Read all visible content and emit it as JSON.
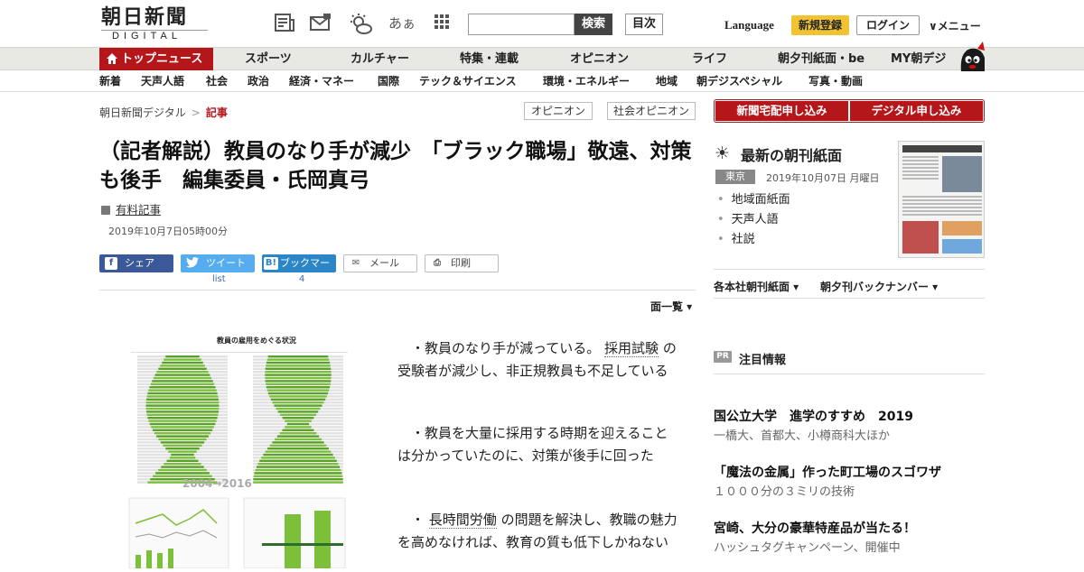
{
  "header": {
    "logo_main": "朝日新聞",
    "logo_sub": "DIGITAL",
    "search_placeholder": "",
    "search_button": "検索",
    "toc_button": "目次",
    "font_toggle_label": "あぁ",
    "language": "Language",
    "signup": "新規登録",
    "login": "ログイン",
    "menu": "∨メニュー"
  },
  "nav_primary": [
    "トップニュース",
    "スポーツ",
    "カルチャー",
    "特集・連載",
    "オピニオン",
    "ライフ",
    "朝夕刊紙面・be",
    "MY朝デジ"
  ],
  "nav_secondary": [
    "新着",
    "天声人語",
    "社会",
    "政治",
    "経済・マネー",
    "国際",
    "テック＆サイエンス",
    "環境・エネルギー",
    "地域",
    "朝デジスペシャル",
    "写真・動画"
  ],
  "breadcrumb": {
    "home": "朝日新聞デジタル",
    "sep": ">",
    "current": "記事"
  },
  "tags": [
    "オピニオン",
    "社会オピニオン"
  ],
  "article": {
    "title": "（記者解説）教員のなり手が減少　「ブラック職場」敬遠、対策も後手　編集委員・氏岡真弓",
    "paid_label": "有料記事",
    "date": "2019年10月7日05時00分",
    "share": {
      "facebook": "シェア",
      "twitter": "ツイート",
      "hatena": "ブックマーク",
      "mail": "メール",
      "print": "印刷",
      "twitter_count": "list",
      "hatena_count": "4"
    },
    "page_list": "面一覧 ▾",
    "figure_title": "教員の雇用をめぐる状況",
    "figure_years": "2004→2016",
    "paragraphs": [
      {
        "pre": "・教員のなり手が減っている。",
        "kw": "採用試験",
        "post": "の受験者が減少し、非正規教員も不足している"
      },
      {
        "pre": "・教員を大量に採用する時期を迎えることは分かっていたのに、対策が後手に回った",
        "kw": "",
        "post": ""
      },
      {
        "pre": "・",
        "kw": "長時間労働",
        "post": "の問題を解決し、教職の魅力を高めなければ、教育の質も低下しかねない"
      }
    ]
  },
  "sidebar": {
    "delivery_button": "新聞宅配申し込み",
    "digital_button": "デジタル申し込み",
    "paper_heading": "最新の朝刊紙面",
    "region": "東京",
    "paper_date": "2019年10月07日 月曜日",
    "paper_links": [
      "地域面紙面",
      "天声人語",
      "社説"
    ],
    "dropdown_1": "各本社朝刊紙面 ▾",
    "dropdown_2": "朝夕刊バックナンバー ▾",
    "pr_badge": "PR",
    "pr_heading": "注目情報",
    "ads": [
      {
        "title": "国公立大学　進学のすすめ　2019",
        "sub": "一橋大、首都大、小樽商科大ほか"
      },
      {
        "title": "「魔法の金属」作った町工場のスゴワザ",
        "sub": "１０００分の３ミリの技術"
      },
      {
        "title": "宮崎、大分の豪華特産品が当たる！",
        "sub": "ハッシュタグキャンペーン、開催中"
      }
    ]
  },
  "colors": {
    "brand_red": "#b5161a",
    "signup_yellow": "#f1c232",
    "facebook": "#3b5998",
    "twitter": "#55acee",
    "hatena": "#2c85c6",
    "chart_green": "#7bbf3a"
  }
}
